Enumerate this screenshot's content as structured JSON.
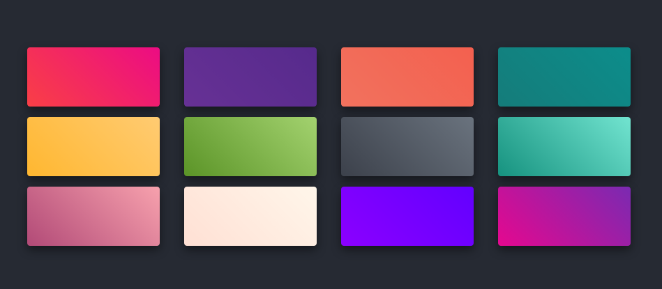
{
  "swatches": [
    {
      "name": "swatch-red-pink",
      "from": "#f93f46",
      "to": "#ec0c83"
    },
    {
      "name": "swatch-purple",
      "from": "#673195",
      "to": "#562a8c"
    },
    {
      "name": "swatch-coral",
      "from": "#f2725e",
      "to": "#f3604f"
    },
    {
      "name": "swatch-teal",
      "from": "#157c7a",
      "to": "#0c8d8b"
    },
    {
      "name": "swatch-yellow",
      "from": "#ffb730",
      "to": "#ffcb72"
    },
    {
      "name": "swatch-green",
      "from": "#5b9427",
      "to": "#a3d26f"
    },
    {
      "name": "swatch-slate",
      "from": "#3c414b",
      "to": "#6a737e"
    },
    {
      "name": "swatch-aqua",
      "from": "#16927f",
      "to": "#72e4d0"
    },
    {
      "name": "swatch-rose",
      "from": "#b24a77",
      "to": "#f7a1ad"
    },
    {
      "name": "swatch-cream",
      "from": "#ffe0d4",
      "to": "#fff6ea"
    },
    {
      "name": "swatch-violet",
      "from": "#8b00ff",
      "to": "#6200ff"
    },
    {
      "name": "swatch-magenta",
      "from": "#e5088f",
      "to": "#7a2ab1"
    }
  ]
}
